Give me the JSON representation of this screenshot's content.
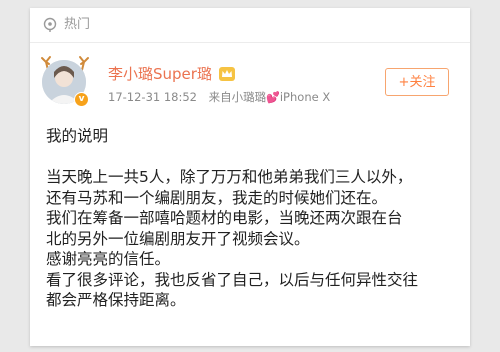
{
  "header": {
    "label": "热门"
  },
  "post": {
    "username": "李小璐Super璐",
    "timestamp": "17-12-31 18:52",
    "source_prefix": "来自小璐璐",
    "source_device": "iPhone X",
    "follow_label": "+关注",
    "title": "我的说明",
    "paragraphs": [
      "当天晚上一共5人，除了万万和他弟弟我们三人以外，",
      "还有马苏和一个编剧朋友，我走的时候她们还在。",
      "我们在筹备一部嘻哈题材的电影，当晚还两次跟在台",
      "北的另外一位编剧朋友开了视频会议。",
      "感谢亮亮的信任。",
      "看了很多评论，我也反省了自己，以后与任何异性交往",
      "都会严格保持距离。"
    ]
  },
  "colors": {
    "accent": "#eb7350",
    "follow": "#ff8140",
    "badge": "#f7a21b"
  }
}
